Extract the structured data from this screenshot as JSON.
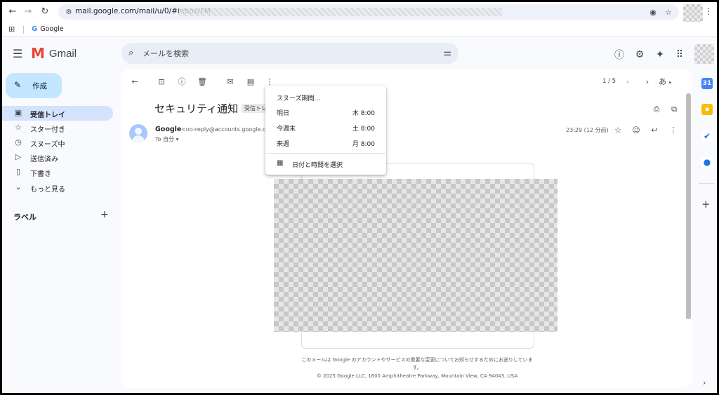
{
  "browser": {
    "url": "mail.google.com/mail/u/0/#inbox/FM",
    "bookmark_google": "Google"
  },
  "header": {
    "app_name": "Gmail",
    "search_placeholder": "メールを検索"
  },
  "nav": {
    "compose_label": "作成",
    "items": [
      {
        "label": "受信トレイ",
        "icon": "inbox-icon",
        "active": true
      },
      {
        "label": "スター付き",
        "icon": "star-icon"
      },
      {
        "label": "スヌーズ中",
        "icon": "clock-icon"
      },
      {
        "label": "送信済み",
        "icon": "send-icon"
      },
      {
        "label": "下書き",
        "icon": "draft-icon"
      },
      {
        "label": "もっと見る",
        "icon": "chevron-down-icon"
      }
    ],
    "labels_heading": "ラベル"
  },
  "toolbar": {
    "pager": "1 / 5",
    "language": "あ"
  },
  "message": {
    "subject": "セキュリティ通知",
    "label_tag": "受信トレイ",
    "sender_name": "Google",
    "sender_email": "<no-reply@accounts.google.com>",
    "to": "To 自分",
    "time": "23:29 (12 分前)",
    "footer": "このメールは Google のアカウントやサービスの重要な変更についてお知らせするためにお送りしています。",
    "copyright": "© 2025 Google LLC, 1600 Amphitheatre Parkway, Mountain View, CA 94043, USA"
  },
  "snooze_menu": {
    "title": "スヌーズ期間...",
    "options": [
      {
        "label": "明日",
        "time": "木 8:00"
      },
      {
        "label": "今週末",
        "time": "土 8:00"
      },
      {
        "label": "来週",
        "time": "月 8:00"
      }
    ],
    "pick_label": "日付と時間を選択"
  },
  "colors": {
    "compose_bg": "#c2e7ff",
    "active_nav_bg": "#d3e3fd",
    "gmail_red": "#ea4335"
  }
}
